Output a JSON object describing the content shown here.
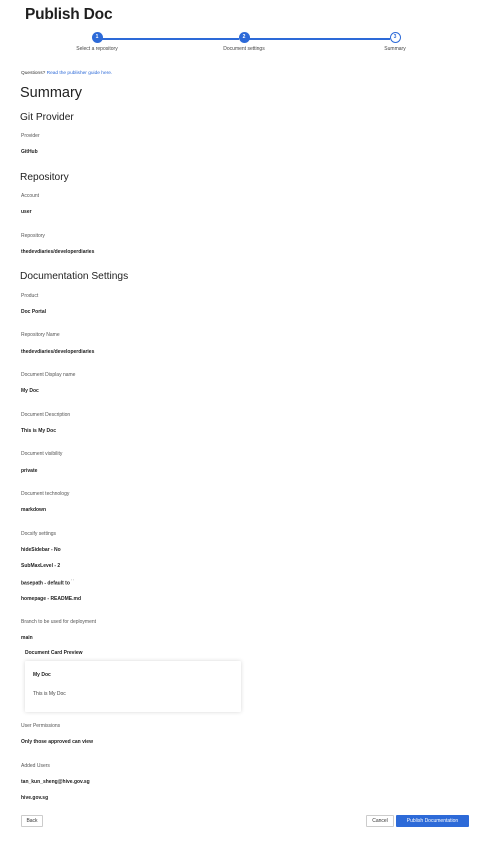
{
  "header": {
    "title": "Publish Doc"
  },
  "stepper": {
    "steps": [
      {
        "number": "1",
        "label": "Select a repository"
      },
      {
        "number": "2",
        "label": "Document settings"
      },
      {
        "number": "3",
        "label": "Summary"
      }
    ]
  },
  "colors": {
    "accent": "#2d6ad8"
  },
  "help": {
    "prefix": "Questions? ",
    "link": "Read the publisher guide here."
  },
  "summary": {
    "title": "Summary",
    "git_provider": {
      "heading": "Git Provider",
      "provider_label": "Provider",
      "provider_value": "GitHub"
    },
    "repository": {
      "heading": "Repository",
      "account_label": "Account",
      "account_value": "user",
      "repo_label": "Repository",
      "repo_value": "thedevdiaries/developerdiaries"
    },
    "doc_settings": {
      "heading": "Documentation Settings",
      "product_label": "Product",
      "product_value": "Doc Portal",
      "repo_name_label": "Repository Name",
      "repo_name_value": "thedevdiaries/developerdiaries",
      "display_name_label": "Document Display name",
      "display_name_value": "My Doc",
      "description_label": "Document Description",
      "description_value": "This is My Doc",
      "visibility_label": "Document visibility",
      "visibility_value": "private",
      "technology_label": "Document technology",
      "technology_value": "markdown",
      "docsify_label": "Docsify settings",
      "docsify_hide_sidebar": "hideSidebar - No",
      "docsify_submaxlevel": "SubMaxLevel - 2",
      "docsify_basepath": "basepath - default to",
      "docsify_basepath_sup": "' '",
      "docsify_homepage": "homepage - README.md",
      "branch_label": "Branch to be used for deployment",
      "branch_value": "main"
    },
    "card_preview": {
      "title": "Document Card Preview",
      "card_title": "My Doc",
      "card_description": "This is My Doc"
    },
    "permissions": {
      "label": "User Permissions",
      "value": "Only those approved can view"
    },
    "added_users": {
      "label": "Added Users",
      "users": [
        "tan_kun_sheng@hive.gov.sg",
        "hive.gov.sg"
      ]
    }
  },
  "footer": {
    "back_label": "Back",
    "cancel_label": "Cancel",
    "publish_label": "Publish Documentation"
  }
}
